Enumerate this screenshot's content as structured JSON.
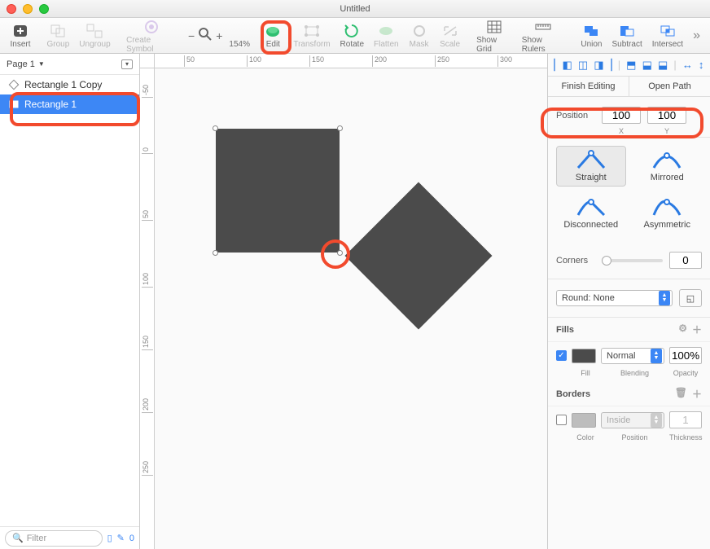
{
  "window": {
    "title": "Untitled"
  },
  "toolbar": {
    "insert": "Insert",
    "group": "Group",
    "ungroup": "Ungroup",
    "createSymbol": "Create Symbol",
    "zoomPercent": "154%",
    "edit": "Edit",
    "transform": "Transform",
    "rotate": "Rotate",
    "flatten": "Flatten",
    "mask": "Mask",
    "scale": "Scale",
    "showGrid": "Show Grid",
    "showRulers": "Show Rulers",
    "union": "Union",
    "subtract": "Subtract",
    "intersect": "Intersect"
  },
  "sidebar": {
    "pageLabel": "Page 1",
    "layers": [
      {
        "name": "Rectangle 1 Copy",
        "selected": false
      },
      {
        "name": "Rectangle 1",
        "selected": true
      }
    ],
    "filterPlaceholder": "Filter",
    "unusedSymbolsCount": "0"
  },
  "rulerH": [
    "50",
    "100",
    "150",
    "200",
    "250",
    "300"
  ],
  "rulerV": [
    "-50",
    "0",
    "50",
    "100",
    "150",
    "200",
    "250"
  ],
  "inspector": {
    "finishEditing": "Finish Editing",
    "openPath": "Open Path",
    "positionLabel": "Position",
    "posX": "100",
    "posY": "100",
    "xLabel": "X",
    "yLabel": "Y",
    "pointTypes": {
      "straight": "Straight",
      "mirrored": "Mirrored",
      "disconnected": "Disconnected",
      "asymmetric": "Asymmetric"
    },
    "cornersLabel": "Corners",
    "cornersValue": "0",
    "roundSelect": "Round: None",
    "fillsHeader": "Fills",
    "fillEnabled": true,
    "fillColor": "#4b4b4b",
    "blendMode": "Normal",
    "fillOpacity": "100%",
    "fillLabel": "Fill",
    "blendLabel": "Blending",
    "opacityLabel": "Opacity",
    "bordersHeader": "Borders",
    "borderEnabled": false,
    "borderColor": "#bdbdbd",
    "borderPos": "Inside",
    "borderThickness": "1",
    "colorLabel": "Color",
    "positionLabel2": "Position",
    "thicknessLabel": "Thickness"
  }
}
